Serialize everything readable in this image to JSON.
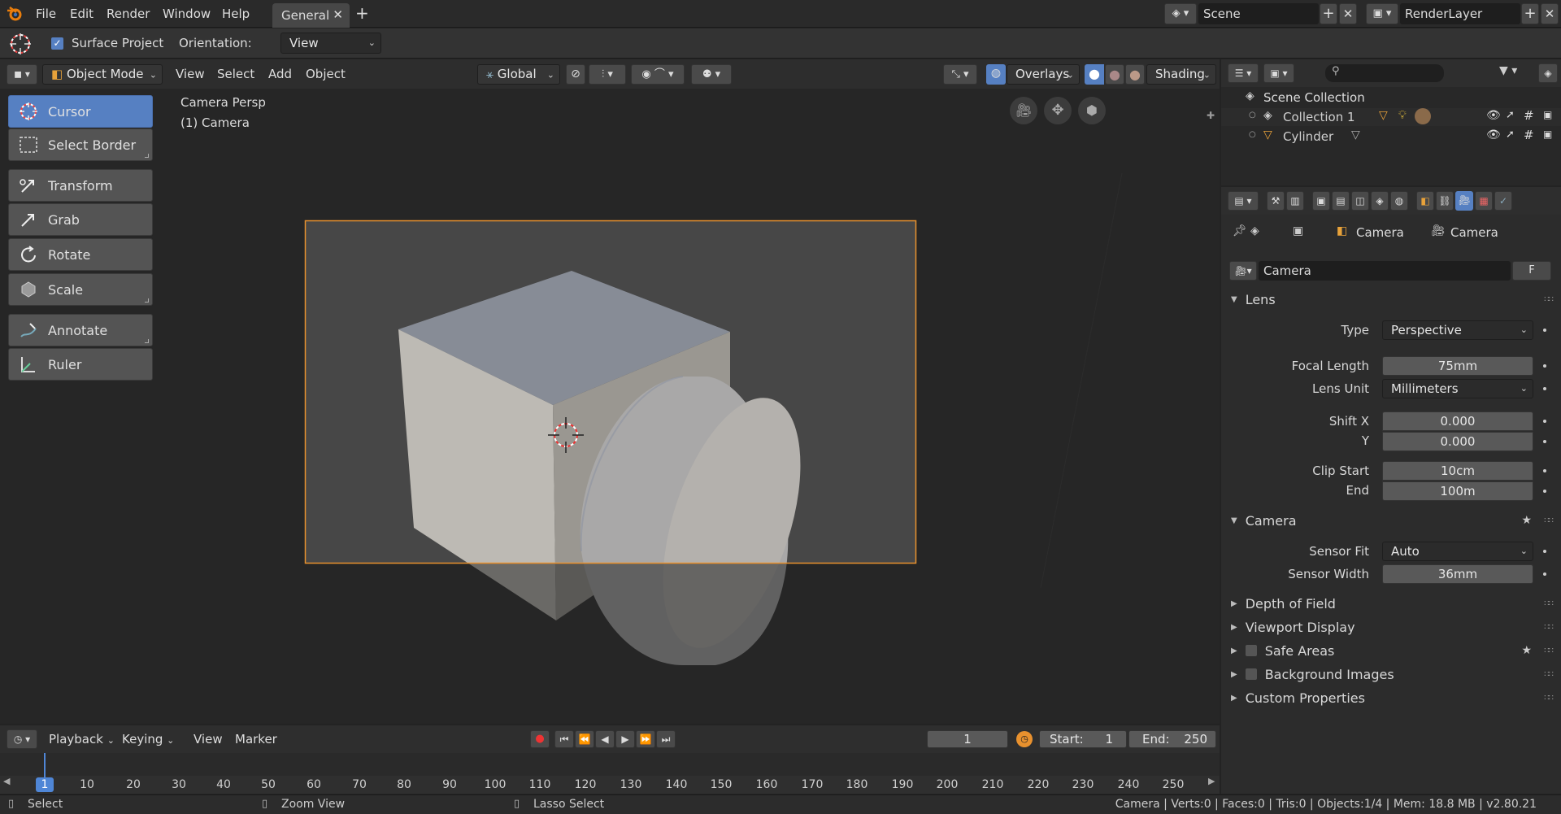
{
  "menubar": {
    "items": [
      "File",
      "Edit",
      "Render",
      "Window",
      "Help"
    ],
    "workspace_tab": "General",
    "scene_label": "Scene",
    "layer_label": "RenderLayer"
  },
  "tool_settings": {
    "surface_project_label": "Surface Project",
    "surface_project_checked": true,
    "orientation_label": "Orientation:",
    "orientation_value": "View"
  },
  "viewport_header": {
    "mode": "Object Mode",
    "menus": [
      "View",
      "Select",
      "Add",
      "Object"
    ],
    "transform_orientation": "Global",
    "overlays": "Overlays",
    "shading": "Shading"
  },
  "toolbar": {
    "tools": [
      "Cursor",
      "Select Border",
      "Transform",
      "Grab",
      "Rotate",
      "Scale",
      "Annotate",
      "Ruler"
    ],
    "active": "Cursor"
  },
  "viewport": {
    "view_name": "Camera Persp",
    "object_name": "(1) Camera"
  },
  "outliner": {
    "root": "Scene Collection",
    "items": [
      "Collection 1",
      "Cylinder"
    ]
  },
  "properties": {
    "breadcrumb": [
      "Camera",
      "Camera"
    ],
    "datablock": "Camera",
    "fake_user": "F",
    "lens": {
      "title": "Lens",
      "type_label": "Type",
      "type_value": "Perspective",
      "focal_label": "Focal Length",
      "focal_value": "75mm",
      "unit_label": "Lens Unit",
      "unit_value": "Millimeters",
      "shiftx_label": "Shift X",
      "shiftx_value": "0.000",
      "shifty_label": "Y",
      "shifty_value": "0.000",
      "clipstart_label": "Clip Start",
      "clipstart_value": "10cm",
      "clipend_label": "End",
      "clipend_value": "100m"
    },
    "camera": {
      "title": "Camera",
      "fit_label": "Sensor Fit",
      "fit_value": "Auto",
      "width_label": "Sensor Width",
      "width_value": "36mm"
    },
    "collapsed": [
      "Depth of Field",
      "Viewport Display",
      "Safe Areas",
      "Background Images",
      "Custom Properties"
    ]
  },
  "timeline": {
    "menus": [
      "Playback",
      "Keying",
      "View",
      "Marker"
    ],
    "current_frame": "1",
    "start_label": "Start:",
    "start_value": "1",
    "end_label": "End:",
    "end_value": "250",
    "ticks": [
      "1",
      "10",
      "20",
      "30",
      "40",
      "50",
      "60",
      "70",
      "80",
      "90",
      "100",
      "110",
      "120",
      "130",
      "140",
      "150",
      "160",
      "170",
      "180",
      "190",
      "200",
      "210",
      "220",
      "230",
      "240",
      "250"
    ]
  },
  "statusbar": {
    "select": "Select",
    "zoom": "Zoom View",
    "lasso": "Lasso Select",
    "info": "Camera | Verts:0 | Faces:0 | Tris:0 | Objects:1/4 | Mem: 18.8 MB | v2.80.21"
  },
  "colors": {
    "accent": "#5680c2",
    "camera_frame": "#e8912e",
    "active_frame": "#4f86d6"
  }
}
